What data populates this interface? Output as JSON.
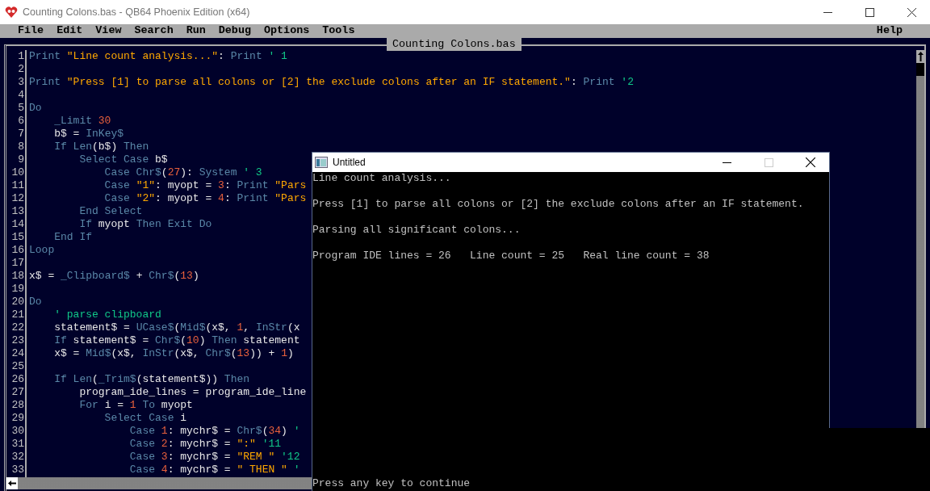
{
  "window": {
    "title": "Counting Colons.bas - QB64 Phoenix Edition (x64)"
  },
  "menu": [
    "File",
    "Edit",
    "View",
    "Search",
    "Run",
    "Debug",
    "Options",
    "Tools"
  ],
  "help_menu": "Help",
  "editor": {
    "file_tab": "Counting Colons.bas",
    "lines": [
      {
        "number": "1",
        "tokens": [
          {
            "kind": "keyword",
            "text": "Print"
          },
          {
            "kind": "string",
            "text": " \"Line count analysis...\""
          },
          {
            "kind": "plain",
            "text": ":"
          },
          {
            "kind": "keyword",
            "text": " Print"
          },
          {
            "kind": "comment",
            "text": " ' 1"
          }
        ]
      },
      {
        "number": "2"
      },
      {
        "number": "3",
        "tokens": [
          {
            "kind": "keyword",
            "text": "Print"
          },
          {
            "kind": "string",
            "text": " \"Press [1] to parse all colons or [2] the exclude colons after an IF statement.\""
          },
          {
            "kind": "plain",
            "text": ":"
          },
          {
            "kind": "keyword",
            "text": " Print"
          },
          {
            "kind": "comment",
            "text": " '2"
          }
        ]
      },
      {
        "number": "4"
      },
      {
        "number": "5",
        "tokens": [
          {
            "kind": "keyword",
            "text": "Do"
          }
        ]
      },
      {
        "number": "6",
        "tokens": [
          {
            "kind": "keyword",
            "text": "    _Limit"
          },
          {
            "kind": "number",
            "text": " 30"
          }
        ]
      },
      {
        "number": "7",
        "tokens": [
          {
            "kind": "plain",
            "text": "    b$ ="
          },
          {
            "kind": "keyword",
            "text": " InKey$"
          }
        ]
      },
      {
        "number": "8",
        "tokens": [
          {
            "kind": "keyword",
            "text": "    If Len"
          },
          {
            "kind": "plain",
            "text": "(b$)"
          },
          {
            "kind": "keyword",
            "text": " Then"
          }
        ]
      },
      {
        "number": "9",
        "tokens": [
          {
            "kind": "keyword",
            "text": "        Select Case"
          },
          {
            "kind": "plain",
            "text": " b$"
          }
        ]
      },
      {
        "number": "10",
        "tokens": [
          {
            "kind": "keyword",
            "text": "            Case Chr$"
          },
          {
            "kind": "plain",
            "text": "("
          },
          {
            "kind": "number",
            "text": "27"
          },
          {
            "kind": "plain",
            "text": "):"
          },
          {
            "kind": "keyword",
            "text": " System"
          },
          {
            "kind": "comment",
            "text": " ' 3"
          }
        ]
      },
      {
        "number": "11",
        "tokens": [
          {
            "kind": "keyword",
            "text": "            Case"
          },
          {
            "kind": "string",
            "text": " \"1\""
          },
          {
            "kind": "plain",
            "text": ": myopt ="
          },
          {
            "kind": "number",
            "text": " 3"
          },
          {
            "kind": "plain",
            "text": ":"
          },
          {
            "kind": "keyword",
            "text": " Print"
          },
          {
            "kind": "string",
            "text": " \"Pars"
          }
        ]
      },
      {
        "number": "12",
        "tokens": [
          {
            "kind": "keyword",
            "text": "            Case"
          },
          {
            "kind": "string",
            "text": " \"2\""
          },
          {
            "kind": "plain",
            "text": ": myopt ="
          },
          {
            "kind": "number",
            "text": " 4"
          },
          {
            "kind": "plain",
            "text": ":"
          },
          {
            "kind": "keyword",
            "text": " Print"
          },
          {
            "kind": "string",
            "text": " \"Pars"
          }
        ]
      },
      {
        "number": "13",
        "tokens": [
          {
            "kind": "keyword",
            "text": "        End Select"
          }
        ]
      },
      {
        "number": "14",
        "tokens": [
          {
            "kind": "keyword",
            "text": "        If"
          },
          {
            "kind": "plain",
            "text": " myopt"
          },
          {
            "kind": "keyword",
            "text": " Then Exit Do"
          }
        ]
      },
      {
        "number": "15",
        "tokens": [
          {
            "kind": "keyword",
            "text": "    End If"
          }
        ]
      },
      {
        "number": "16",
        "tokens": [
          {
            "kind": "keyword",
            "text": "Loop"
          }
        ]
      },
      {
        "number": "17"
      },
      {
        "number": "18",
        "tokens": [
          {
            "kind": "plain",
            "text": "x$ ="
          },
          {
            "kind": "keyword",
            "text": " _Clipboard$"
          },
          {
            "kind": "plain",
            "text": " +"
          },
          {
            "kind": "keyword",
            "text": " Chr$"
          },
          {
            "kind": "plain",
            "text": "("
          },
          {
            "kind": "number",
            "text": "13"
          },
          {
            "kind": "plain",
            "text": ")"
          }
        ]
      },
      {
        "number": "19"
      },
      {
        "number": "20",
        "tokens": [
          {
            "kind": "keyword",
            "text": "Do"
          }
        ]
      },
      {
        "number": "21",
        "tokens": [
          {
            "kind": "comment",
            "text": "    ' parse clipboard"
          }
        ]
      },
      {
        "number": "22",
        "tokens": [
          {
            "kind": "plain",
            "text": "    statement$ ="
          },
          {
            "kind": "keyword",
            "text": " UCase$"
          },
          {
            "kind": "plain",
            "text": "("
          },
          {
            "kind": "keyword",
            "text": "Mid$"
          },
          {
            "kind": "plain",
            "text": "(x$,"
          },
          {
            "kind": "number",
            "text": " 1"
          },
          {
            "kind": "plain",
            "text": ","
          },
          {
            "kind": "keyword",
            "text": " InStr"
          },
          {
            "kind": "plain",
            "text": "(x"
          }
        ]
      },
      {
        "number": "23",
        "tokens": [
          {
            "kind": "keyword",
            "text": "    If"
          },
          {
            "kind": "plain",
            "text": " statement$ ="
          },
          {
            "kind": "keyword",
            "text": " Chr$"
          },
          {
            "kind": "plain",
            "text": "("
          },
          {
            "kind": "number",
            "text": "10"
          },
          {
            "kind": "plain",
            "text": ")"
          },
          {
            "kind": "keyword",
            "text": " Then"
          },
          {
            "kind": "plain",
            "text": " statement"
          }
        ]
      },
      {
        "number": "24",
        "tokens": [
          {
            "kind": "plain",
            "text": "    x$ ="
          },
          {
            "kind": "keyword",
            "text": " Mid$"
          },
          {
            "kind": "plain",
            "text": "(x$,"
          },
          {
            "kind": "keyword",
            "text": " InStr"
          },
          {
            "kind": "plain",
            "text": "(x$,"
          },
          {
            "kind": "keyword",
            "text": " Chr$"
          },
          {
            "kind": "plain",
            "text": "("
          },
          {
            "kind": "number",
            "text": "13"
          },
          {
            "kind": "plain",
            "text": ")) +"
          },
          {
            "kind": "number",
            "text": " 1"
          },
          {
            "kind": "plain",
            "text": ")"
          }
        ]
      },
      {
        "number": "25"
      },
      {
        "number": "26",
        "tokens": [
          {
            "kind": "keyword",
            "text": "    If Len"
          },
          {
            "kind": "plain",
            "text": "("
          },
          {
            "kind": "keyword",
            "text": "_Trim$"
          },
          {
            "kind": "plain",
            "text": "(statement$))"
          },
          {
            "kind": "keyword",
            "text": " Then"
          }
        ]
      },
      {
        "number": "27",
        "tokens": [
          {
            "kind": "plain",
            "text": "        program_ide_lines = program_ide_line"
          }
        ]
      },
      {
        "number": "28",
        "tokens": [
          {
            "kind": "keyword",
            "text": "        For"
          },
          {
            "kind": "plain",
            "text": " i ="
          },
          {
            "kind": "number",
            "text": " 1"
          },
          {
            "kind": "keyword",
            "text": " To"
          },
          {
            "kind": "plain",
            "text": " myopt"
          }
        ]
      },
      {
        "number": "29",
        "tokens": [
          {
            "kind": "keyword",
            "text": "            Select Case"
          },
          {
            "kind": "plain",
            "text": " i"
          }
        ]
      },
      {
        "number": "30",
        "tokens": [
          {
            "kind": "keyword",
            "text": "                Case"
          },
          {
            "kind": "number",
            "text": " 1"
          },
          {
            "kind": "plain",
            "text": ": mychr$ ="
          },
          {
            "kind": "keyword",
            "text": " Chr$"
          },
          {
            "kind": "plain",
            "text": "("
          },
          {
            "kind": "number",
            "text": "34"
          },
          {
            "kind": "plain",
            "text": ")"
          },
          {
            "kind": "comment",
            "text": " '"
          }
        ]
      },
      {
        "number": "31",
        "tokens": [
          {
            "kind": "keyword",
            "text": "                Case"
          },
          {
            "kind": "number",
            "text": " 2"
          },
          {
            "kind": "plain",
            "text": ": mychr$ ="
          },
          {
            "kind": "string",
            "text": " \":\""
          },
          {
            "kind": "comment",
            "text": " '11"
          }
        ]
      },
      {
        "number": "32",
        "tokens": [
          {
            "kind": "keyword",
            "text": "                Case"
          },
          {
            "kind": "number",
            "text": " 3"
          },
          {
            "kind": "plain",
            "text": ": mychr$ ="
          },
          {
            "kind": "string",
            "text": " \"REM \""
          },
          {
            "kind": "comment",
            "text": " '12"
          }
        ]
      },
      {
        "number": "33",
        "tokens": [
          {
            "kind": "keyword",
            "text": "                Case"
          },
          {
            "kind": "number",
            "text": " 4"
          },
          {
            "kind": "plain",
            "text": ": mychr$ ="
          },
          {
            "kind": "string",
            "text": " \" THEN \""
          },
          {
            "kind": "comment",
            "text": " '"
          }
        ]
      }
    ]
  },
  "output_window": {
    "title": "Untitled",
    "lines": [
      "Line count analysis...",
      "Press [1] to parse all colons or [2] the exclude colons after an IF statement.",
      "Parsing all significant colons...",
      "Program IDE lines = 26   Line count = 25   Real line count = 38"
    ],
    "prompt": "Press any key to continue"
  }
}
